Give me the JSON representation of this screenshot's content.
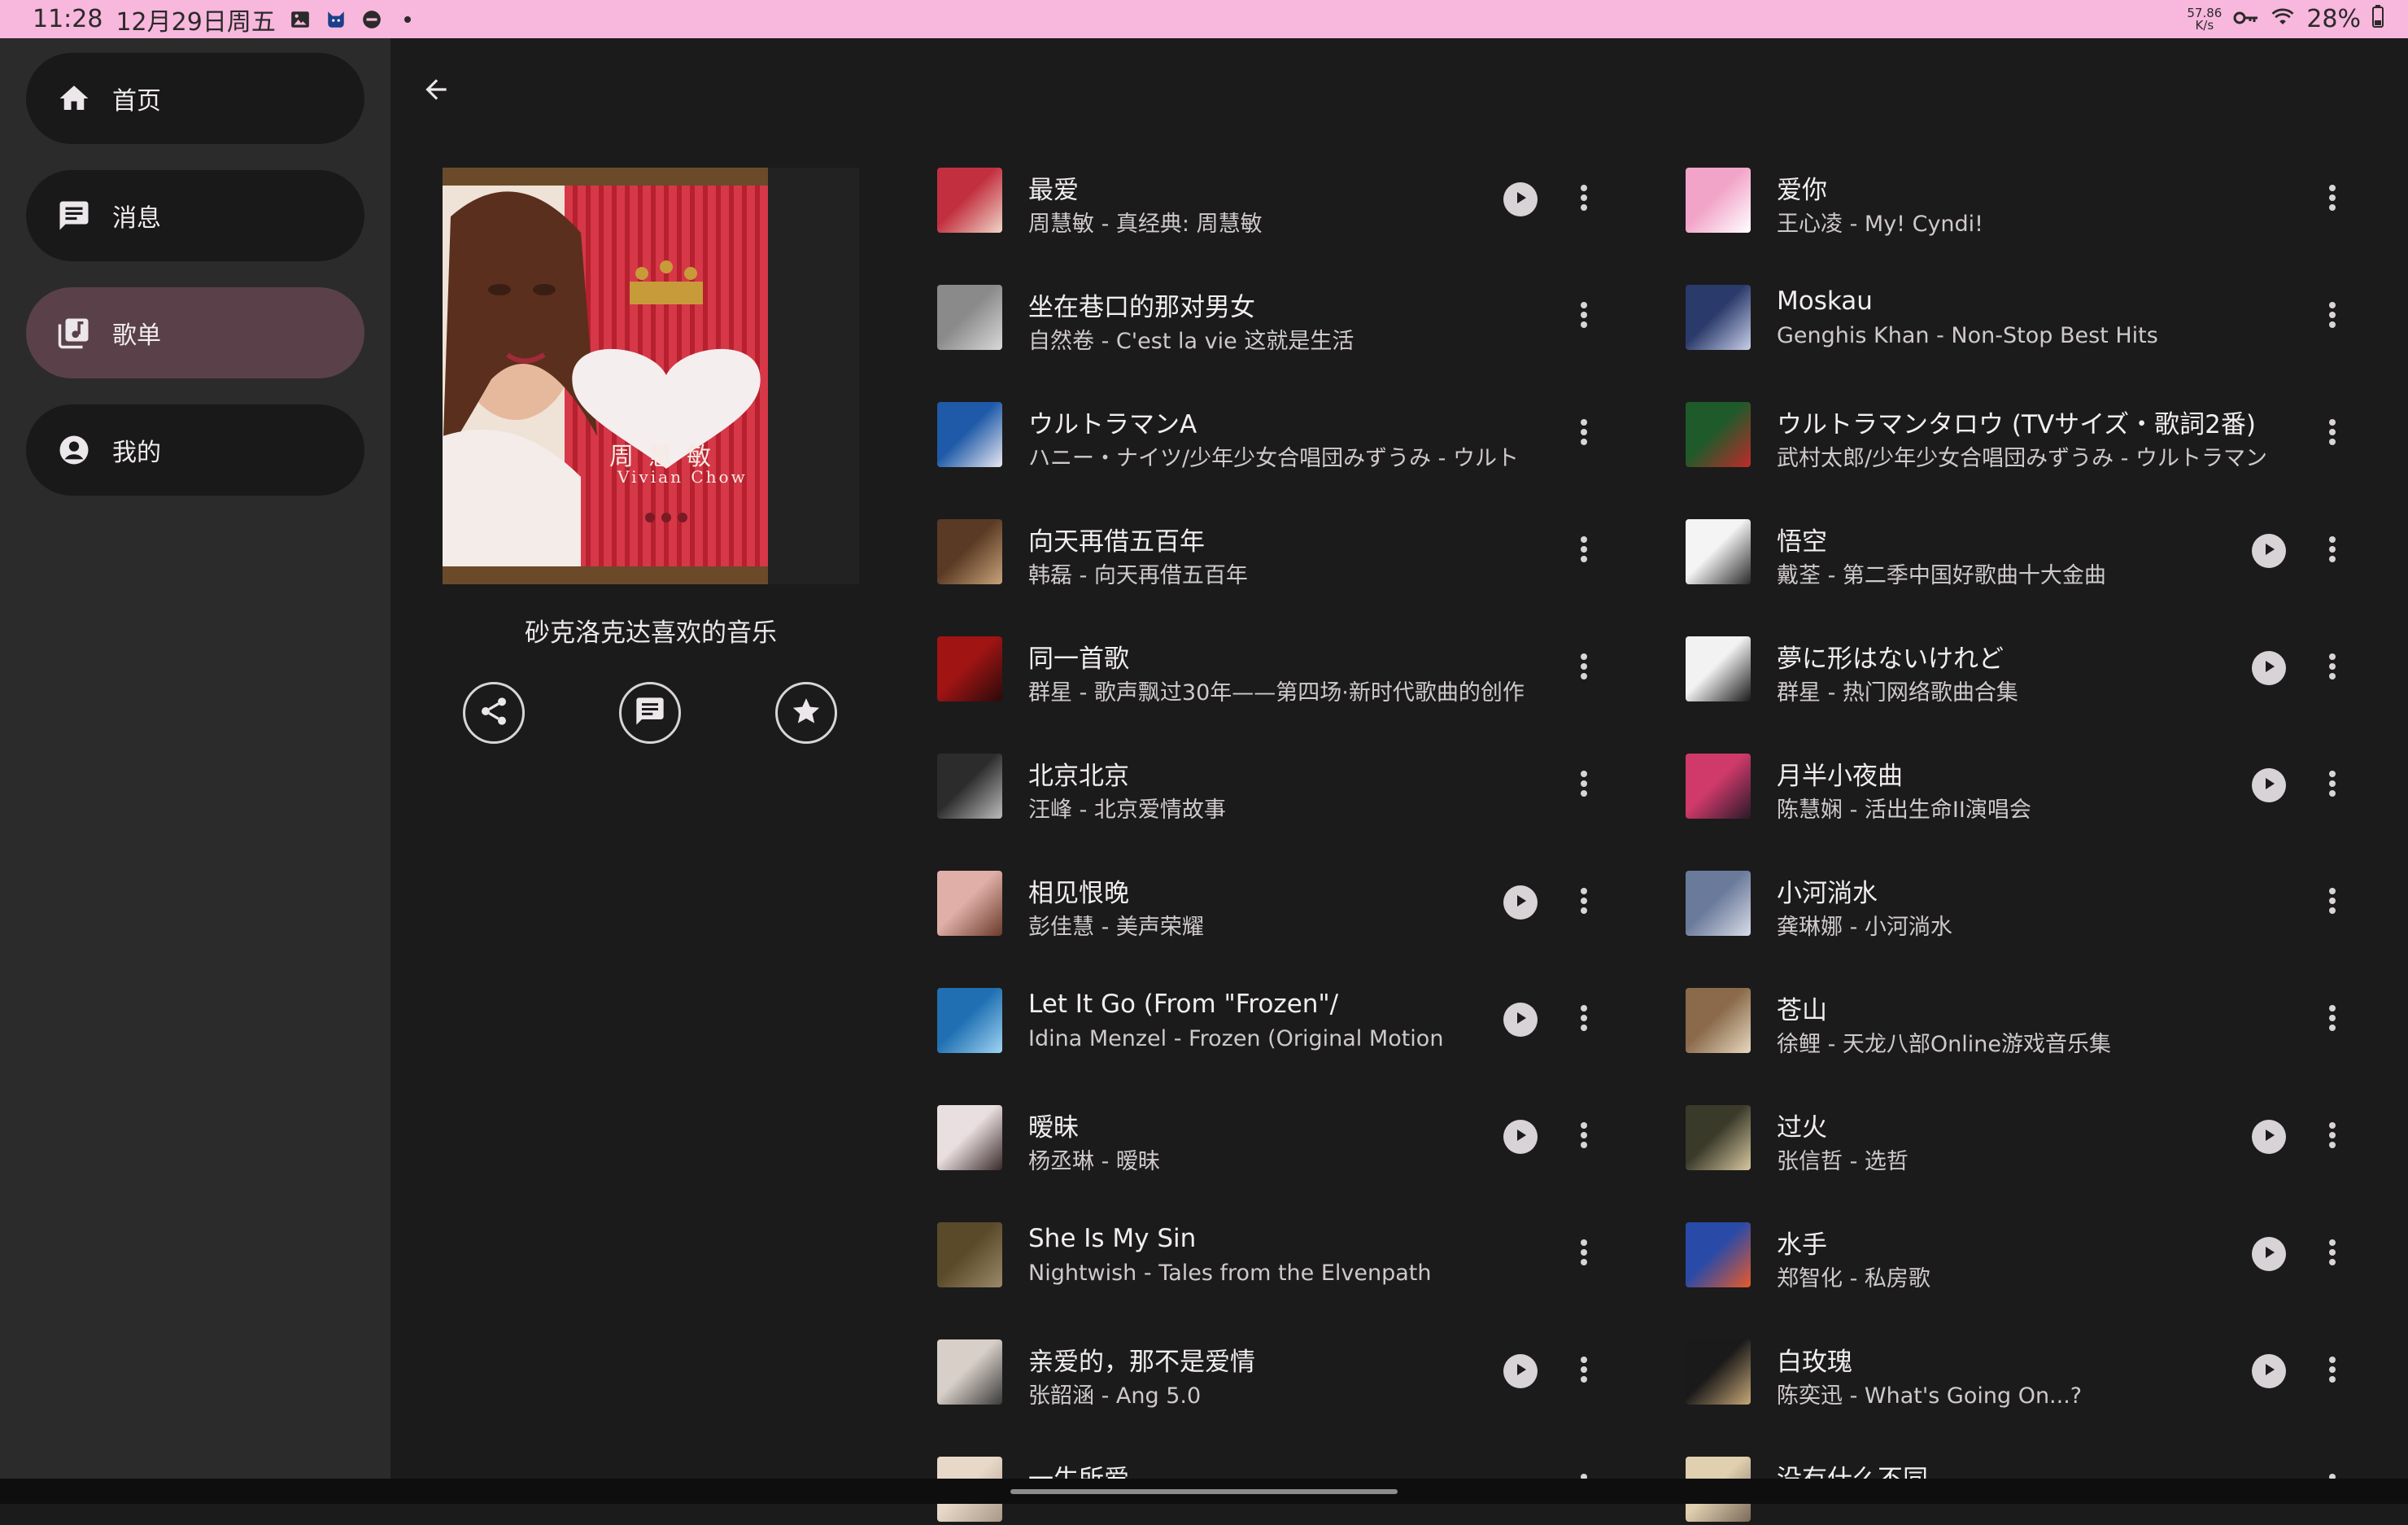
{
  "status_bar": {
    "time": "11:28",
    "date": "12月29日周五",
    "net_speed_value": "57.86",
    "net_speed_unit": "K/s",
    "battery": "28%"
  },
  "nav": {
    "items": [
      {
        "label": "首页",
        "icon": "home-icon"
      },
      {
        "label": "消息",
        "icon": "message-icon"
      },
      {
        "label": "歌单",
        "icon": "playlist-icon"
      },
      {
        "label": "我的",
        "icon": "account-icon"
      }
    ],
    "active_index": 2
  },
  "playlist": {
    "title": "砂克洛克达喜欢的音乐",
    "cover_text_cn": "周 慧 敏",
    "cover_text_en": "Vivian Chow"
  },
  "songs_left": [
    {
      "title": "最爱",
      "subtitle": "周慧敏 - 真经典: 周慧敏",
      "playable": true
    },
    {
      "title": "坐在巷口的那对男女",
      "subtitle": "自然卷 - C'est la vie 这就是生活",
      "playable": false
    },
    {
      "title": "ウルトラマンA",
      "subtitle": "ハニー・ナイツ/少年少女合唱団みずうみ - ウルト",
      "playable": false
    },
    {
      "title": "向天再借五百年",
      "subtitle": "韩磊 - 向天再借五百年",
      "playable": false
    },
    {
      "title": "同一首歌",
      "subtitle": "群星 - 歌声飘过30年——第四场·新时代歌曲的创作",
      "playable": false
    },
    {
      "title": "北京北京",
      "subtitle": "汪峰 - 北京爱情故事",
      "playable": false
    },
    {
      "title": "相见恨晚",
      "subtitle": "彭佳慧 - 美声荣耀",
      "playable": true
    },
    {
      "title": "Let It Go (From \"Frozen\"/",
      "subtitle": "Idina Menzel - Frozen (Original Motion",
      "playable": true
    },
    {
      "title": "暧昧",
      "subtitle": "杨丞琳 - 暧昧",
      "playable": true
    },
    {
      "title": "She Is My Sin",
      "subtitle": "Nightwish - Tales from the Elvenpath",
      "playable": false
    },
    {
      "title": "亲爱的，那不是爱情",
      "subtitle": "张韶涵 - Ang 5.0",
      "playable": true
    },
    {
      "title": "一生所爱",
      "subtitle": "",
      "playable": false
    }
  ],
  "songs_right": [
    {
      "title": "爱你",
      "subtitle": "王心凌 - My! Cyndi!",
      "playable": false
    },
    {
      "title": "Moskau",
      "subtitle": "Genghis Khan - Non-Stop Best Hits",
      "playable": false
    },
    {
      "title": "ウルトラマンタロウ (TVサイズ・歌詞2番)",
      "subtitle": "武村太郎/少年少女合唱団みずうみ - ウルトラマン",
      "playable": false
    },
    {
      "title": "悟空",
      "subtitle": "戴荃 - 第二季中国好歌曲十大金曲",
      "playable": true
    },
    {
      "title": "夢に形はないけれど",
      "subtitle": "群星 - 热门网络歌曲合集",
      "playable": true
    },
    {
      "title": "月半小夜曲",
      "subtitle": "陈慧娴 - 活出生命II演唱会",
      "playable": true
    },
    {
      "title": "小河淌水",
      "subtitle": "龚琳娜 - 小河淌水",
      "playable": false
    },
    {
      "title": "苍山",
      "subtitle": "徐鲤 - 天龙八部Online游戏音乐集",
      "playable": false
    },
    {
      "title": "过火",
      "subtitle": "张信哲 - 选哲",
      "playable": true
    },
    {
      "title": "水手",
      "subtitle": "郑智化 - 私房歌",
      "playable": true
    },
    {
      "title": "白玫瑰",
      "subtitle": "陈奕迅 - What's Going On...?",
      "playable": true
    },
    {
      "title": "没有什么不同",
      "subtitle": "",
      "playable": false
    }
  ],
  "colors": {
    "status_bar": "#f8b7dc",
    "rail": "#2b2b2b",
    "background": "#1b1b1b",
    "nav_active": "#5a4049"
  }
}
